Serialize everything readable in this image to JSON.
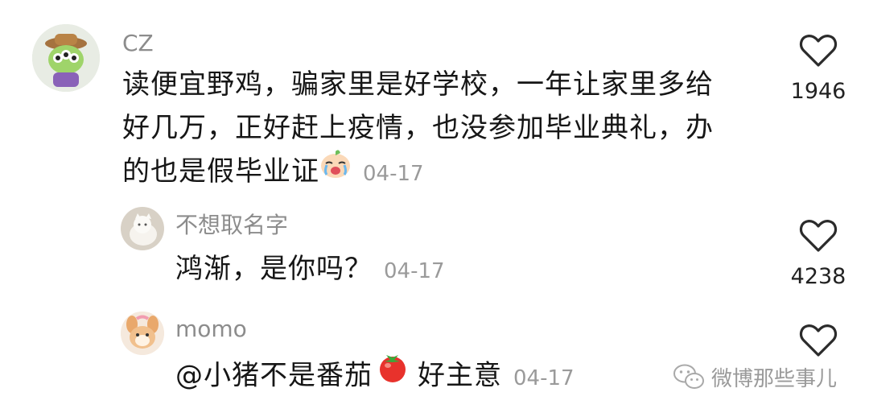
{
  "comments": [
    {
      "username": "CZ",
      "line1": "读便宜野鸡，骗家里是好学校，一年让家里多给",
      "line2": "好几万，正好赶上疫情，也没参加毕业典礼，办",
      "line3": "的也是假毕业证",
      "date": "04-17",
      "likes": "1946",
      "emoji": "crying-face-emoji"
    },
    {
      "username": "不想取名字",
      "text": "鸿渐，是你吗？",
      "date": "04-17",
      "likes": "4238"
    },
    {
      "username": "momo",
      "text_before": "@小猪不是番茄",
      "text_after": "好主意",
      "date": "04-17",
      "emoji": "tomato-emoji"
    }
  ],
  "watermark": {
    "text": "微博那些事儿",
    "icon": "wechat-icon"
  },
  "colors": {
    "username": "#8c8c8c",
    "text": "#161616",
    "date": "#9a9a9a",
    "heart": "#2b2b2b"
  }
}
